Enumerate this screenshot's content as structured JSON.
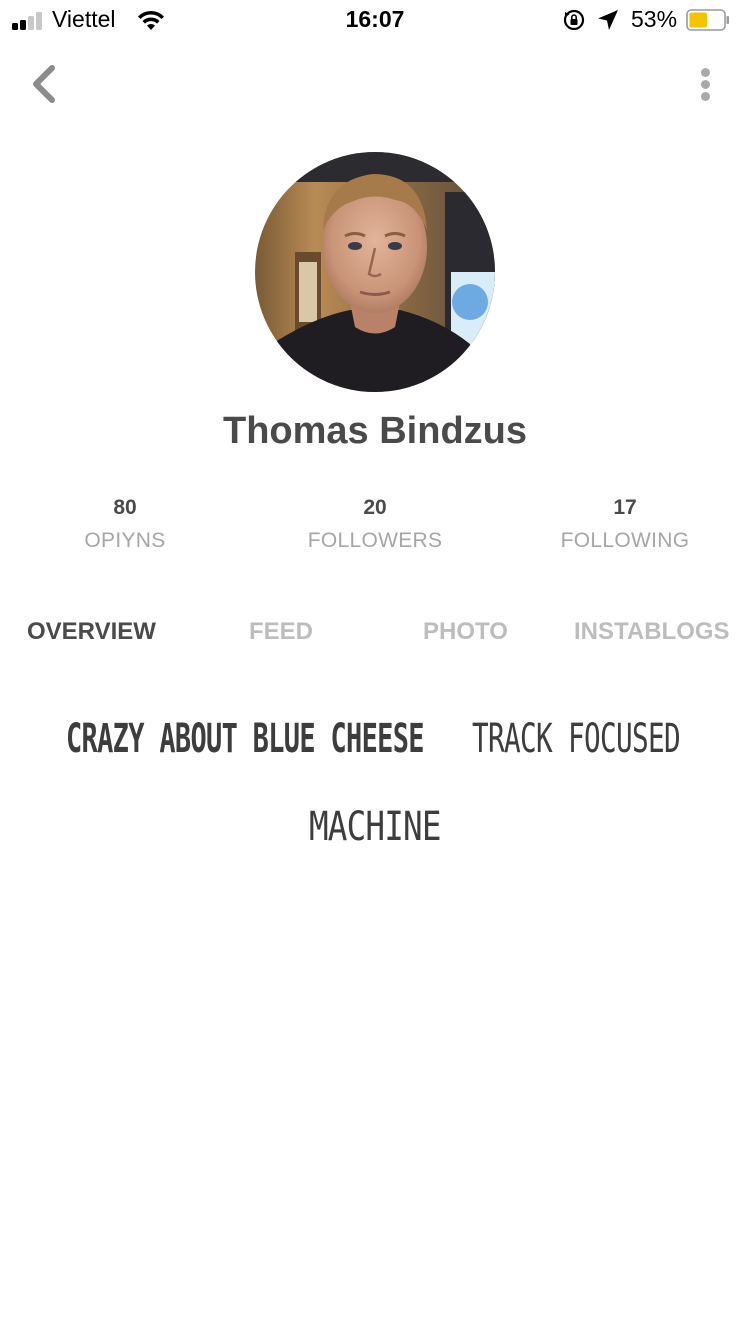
{
  "status_bar": {
    "carrier": "Viettel",
    "time": "16:07",
    "battery_percent": "53%",
    "battery_level": 0.53,
    "battery_color": "#f5c400"
  },
  "nav": {
    "back_icon": "chevron-left-icon",
    "more_icon": "vertical-dots-icon"
  },
  "profile": {
    "name": "Thomas Bindzus",
    "stats": [
      {
        "value": "80",
        "label": "OPIYNS"
      },
      {
        "value": "20",
        "label": "FOLLOWERS"
      },
      {
        "value": "17",
        "label": "FOLLOWING"
      }
    ]
  },
  "tabs": [
    {
      "label": "OVERVIEW",
      "active": true
    },
    {
      "label": "FEED",
      "active": false
    },
    {
      "label": "PHOTO",
      "active": false
    },
    {
      "label": "INSTABLOGS",
      "active": false
    }
  ],
  "tags": [
    {
      "text": "CRAZY ABOUT BLUE CHEESE"
    },
    {
      "text": "TRACK FOCUSED"
    },
    {
      "text": "MACHINE"
    }
  ],
  "colors": {
    "text_dark": "#4a4a4a",
    "text_light": "#a6a6a6",
    "tab_inactive": "#bdbdbd"
  }
}
